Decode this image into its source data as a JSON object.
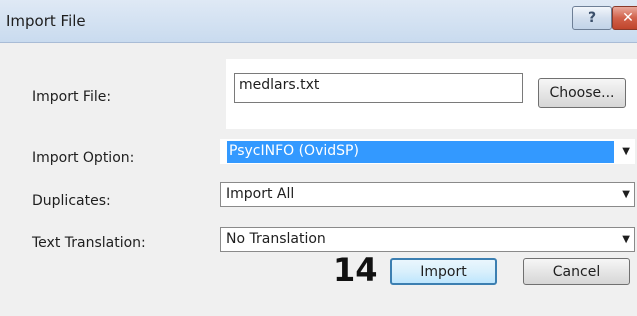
{
  "window": {
    "title": "Import File",
    "help_glyph": "?",
    "close_glyph": "✕"
  },
  "form": {
    "import_file": {
      "label": "Import File:",
      "value": "medlars.txt",
      "choose_label": "Choose..."
    },
    "import_option": {
      "label": "Import Option:",
      "value": "PsycINFO (OvidSP)"
    },
    "duplicates": {
      "label": "Duplicates:",
      "value": "Import All"
    },
    "text_translation": {
      "label": "Text Translation:",
      "value": "No Translation"
    }
  },
  "annotation": {
    "step_number": "14"
  },
  "buttons": {
    "import_label": "Import",
    "cancel_label": "Cancel"
  },
  "colors": {
    "selection_highlight": "#3399ff",
    "titlebar": "#c9dbef",
    "close_button": "#c0452c"
  }
}
